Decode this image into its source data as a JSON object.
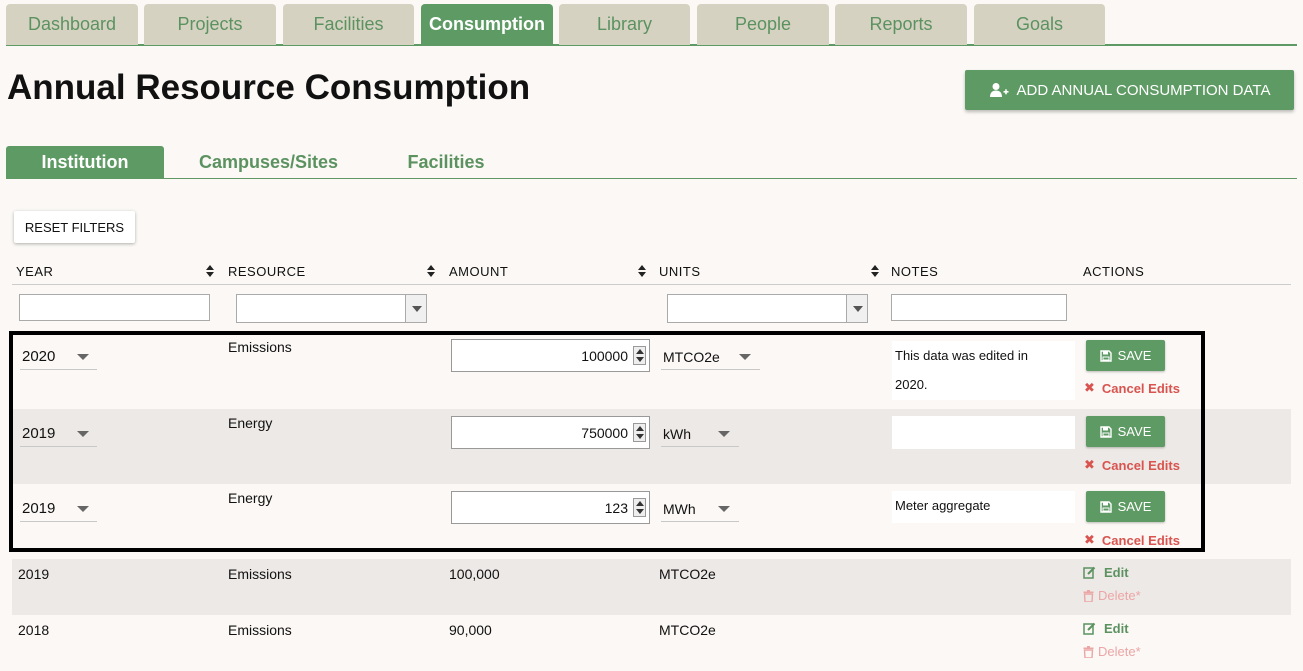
{
  "nav": {
    "tabs": [
      "Dashboard",
      "Projects",
      "Facilities",
      "Consumption",
      "Library",
      "People",
      "Reports",
      "Goals"
    ],
    "active": "Consumption"
  },
  "page": {
    "title": "Annual Resource Consumption",
    "add_button": "ADD ANNUAL CONSUMPTION DATA"
  },
  "subtabs": {
    "items": [
      "Institution",
      "Campuses/Sites",
      "Facilities"
    ],
    "active": "Institution"
  },
  "filters": {
    "reset_label": "RESET FILTERS"
  },
  "table": {
    "headers": [
      "YEAR",
      "RESOURCE",
      "AMOUNT",
      "UNITS",
      "NOTES",
      "ACTIONS"
    ],
    "editing_rows": [
      {
        "year": "2020",
        "resource": "Emissions",
        "amount": "100000",
        "units": "MTCO2e",
        "notes_line1": "This data was edited in",
        "notes_line2": "2020."
      },
      {
        "year": "2019",
        "resource": "Energy",
        "amount": "750000",
        "units": "kWh",
        "notes_line1": "",
        "notes_line2": ""
      },
      {
        "year": "2019",
        "resource": "Energy",
        "amount": "123",
        "units": "MWh",
        "notes_line1": "Meter aggregate",
        "notes_line2": ""
      }
    ],
    "static_rows": [
      {
        "year": "2019",
        "resource": "Emissions",
        "amount": "100,000",
        "units": "MTCO2e"
      },
      {
        "year": "2018",
        "resource": "Emissions",
        "amount": "90,000",
        "units": "MTCO2e"
      }
    ],
    "actions": {
      "save": "SAVE",
      "cancel": "Cancel Edits",
      "edit": "Edit",
      "delete": "Delete*"
    }
  },
  "colors": {
    "accent": "#5e9a63",
    "tab_inactive": "#d6d2c2",
    "cancel": "#d9534f",
    "delete": "#eba6a6"
  }
}
